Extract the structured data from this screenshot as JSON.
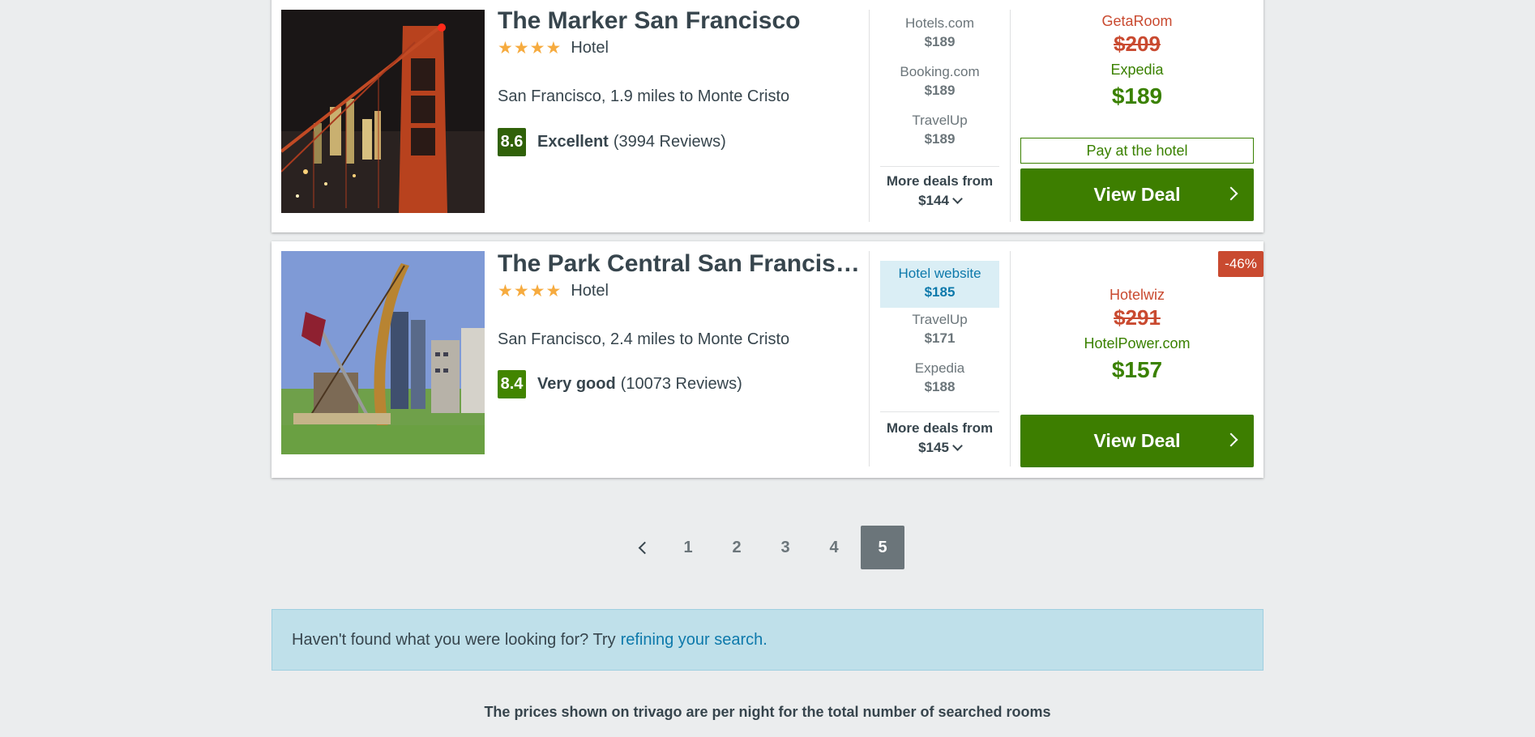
{
  "results": [
    {
      "name": "The Marker San Francisco",
      "stars": 4,
      "type": "Hotel",
      "location": "San Francisco, 1.9 miles to Monte Cristo",
      "score": "8.6",
      "rating_label": "Excellent",
      "reviews": "(3994 Reviews)",
      "deals": [
        {
          "provider": "Hotels.com",
          "price": "$189"
        },
        {
          "provider": "Booking.com",
          "price": "$189"
        },
        {
          "provider": "TravelUp",
          "price": "$189"
        }
      ],
      "more_deals_label": "More deals from",
      "more_deals_price": "$144",
      "old_provider": "GetaRoom",
      "old_price": "$209",
      "best_provider": "Expedia",
      "best_price": "$189",
      "pay_at_hotel": "Pay at the hotel",
      "view_deal": "View Deal"
    },
    {
      "name": "The Park Central San Francisco",
      "stars": 4,
      "type": "Hotel",
      "location": "San Francisco, 2.4 miles to Monte Cristo",
      "score": "8.4",
      "rating_label": "Very good",
      "reviews": "(10073 Reviews)",
      "deals": [
        {
          "provider": "Hotel website",
          "price": "$185"
        },
        {
          "provider": "TravelUp",
          "price": "$171"
        },
        {
          "provider": "Expedia",
          "price": "$188"
        }
      ],
      "more_deals_label": "More deals from",
      "more_deals_price": "$145",
      "discount_badge": "-46%",
      "old_provider": "Hotelwiz",
      "old_price": "$291",
      "best_provider": "HotelPower.com",
      "best_price": "$157",
      "view_deal": "View Deal"
    }
  ],
  "pagination": {
    "pages": [
      "1",
      "2",
      "3",
      "4",
      "5"
    ],
    "current": "5"
  },
  "notice": {
    "text": "Haven't found what you were looking for? Try",
    "link": "refining your search."
  },
  "footnote": "The prices shown on trivago are per night for the total number of searched rooms",
  "colors": {
    "view_deal_green": "#3d7e00",
    "discount_red": "#c94a30",
    "highlight_blue": "#daeef5"
  }
}
